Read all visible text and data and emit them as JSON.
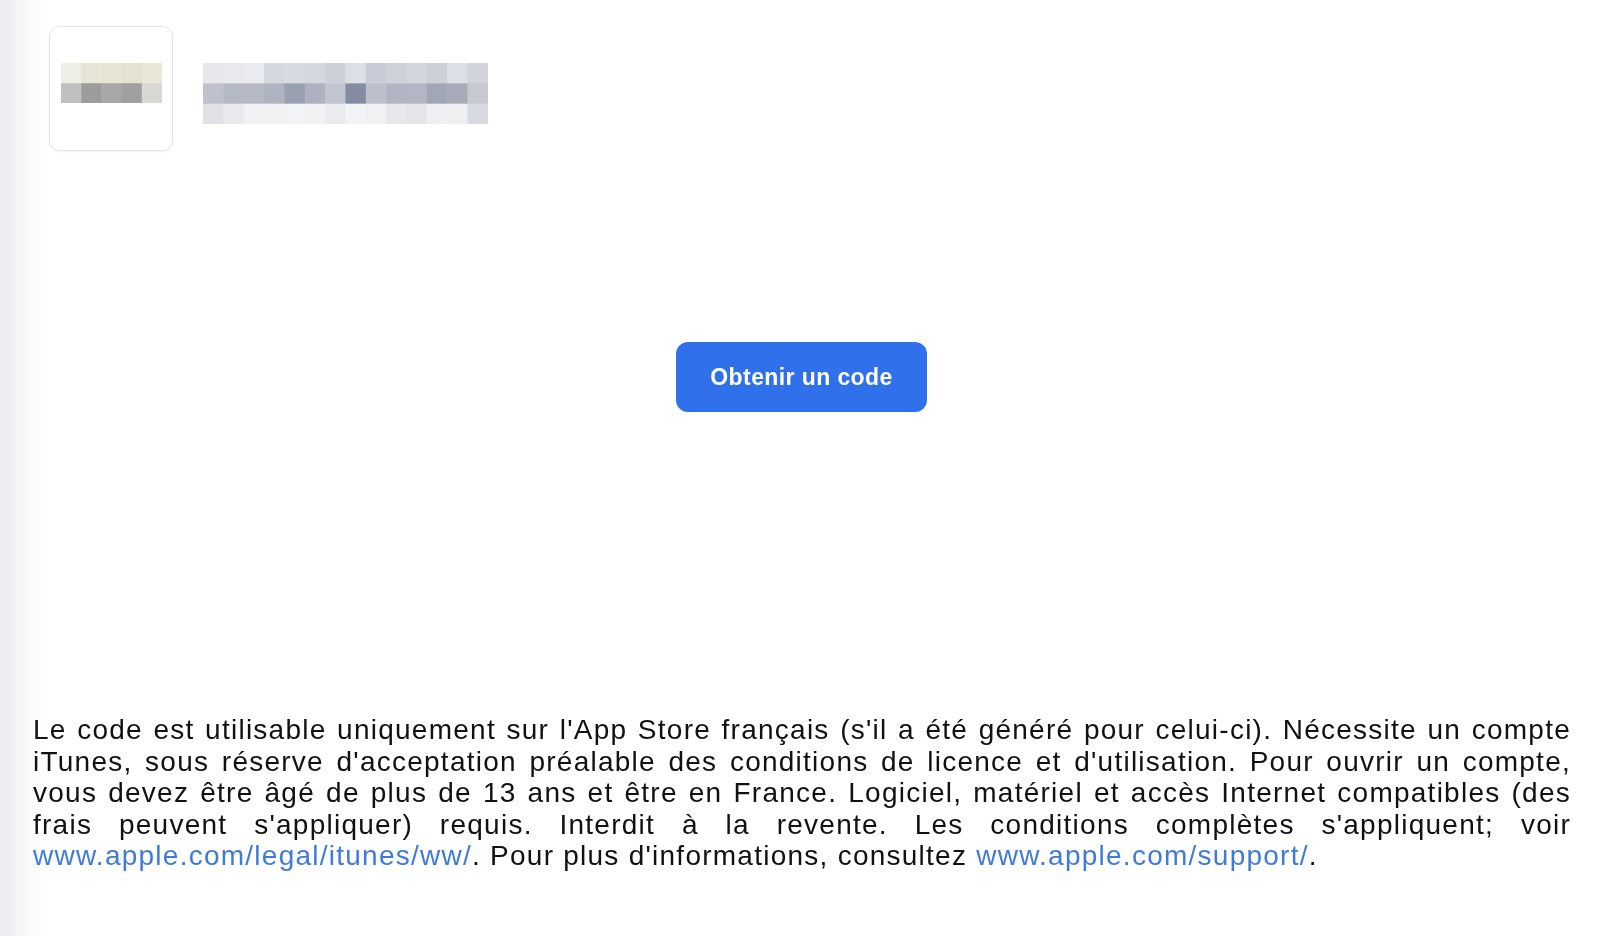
{
  "action_button": {
    "label": "Obtenir un code"
  },
  "legal_notice": {
    "parts": [
      {
        "kind": "text",
        "text": "Le code est utilisable uniquement sur l'App Store français (s'il a été généré pour celui-ci). Nécessite un compte iTunes, sous réserve d'acceptation préalable des conditions de licence et d'utilisation. Pour ouvrir un compte, vous devez être âgé de plus de 13 ans et être en France. Logiciel, matériel et accès Internet compatibles (des frais peuvent s'appliquer) requis. Interdit à la revente. Les conditions complètes s'appliquent; voir "
      },
      {
        "kind": "link",
        "text": "www.apple.com/legal/itunes/ww/"
      },
      {
        "kind": "text",
        "text": ". Pour plus d'informations, consultez "
      },
      {
        "kind": "link",
        "text": "www.apple.com/support/"
      },
      {
        "kind": "text",
        "text": "."
      }
    ]
  }
}
